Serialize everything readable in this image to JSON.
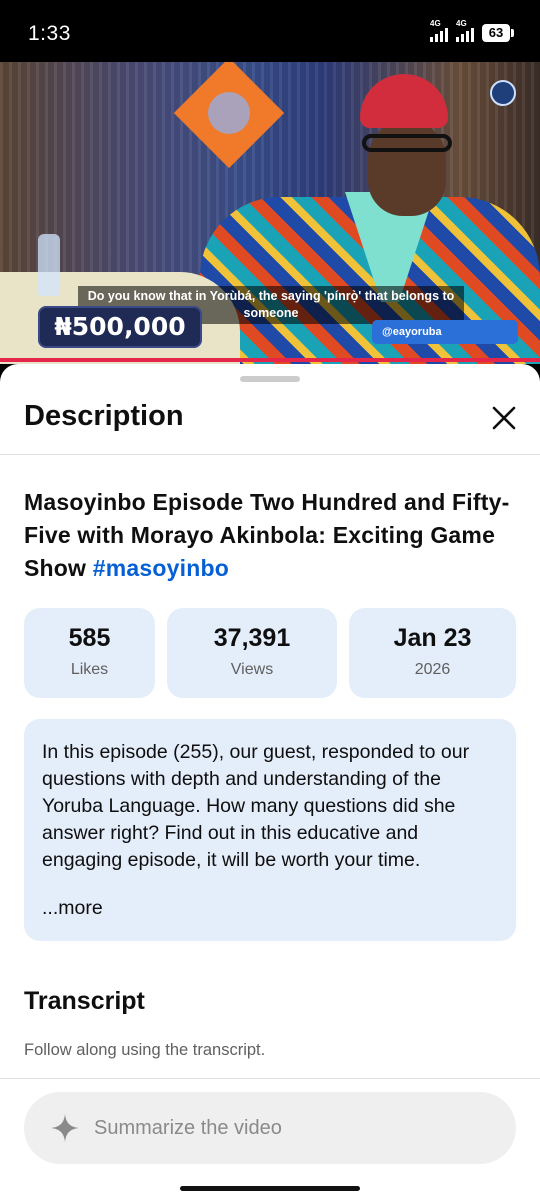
{
  "status_bar": {
    "time": "1:33",
    "signal1": "4G",
    "signal2": "4G",
    "battery": "63"
  },
  "video": {
    "caption": "Do you know that in Yorùbá, the saying 'pínrọ̀' that belongs to someone",
    "prize": "₦500,000",
    "social_handle": "@eayoruba",
    "accent_color": "#e6254a"
  },
  "sheet": {
    "title": "Description",
    "video_title": "Masoyinbo Episode Two Hundred and Fifty-Five with Morayo Akinbola: Exciting Game Show ",
    "hashtag": "#masoyinbo",
    "stats": [
      {
        "value": "585",
        "label": "Likes"
      },
      {
        "value": "37,391",
        "label": "Views"
      },
      {
        "value": "Jan 23",
        "label": "2026"
      }
    ],
    "description": "In this episode (255), our guest, responded to our questions with depth and understanding of the Yoruba Language. How many questions did she answer right? Find out in this educative and engaging episode, it will be worth your time.",
    "more_label": "...more",
    "transcript_title": "Transcript",
    "transcript_sub": "Follow along using the transcript.",
    "ask_placeholder": "Summarize the video"
  }
}
